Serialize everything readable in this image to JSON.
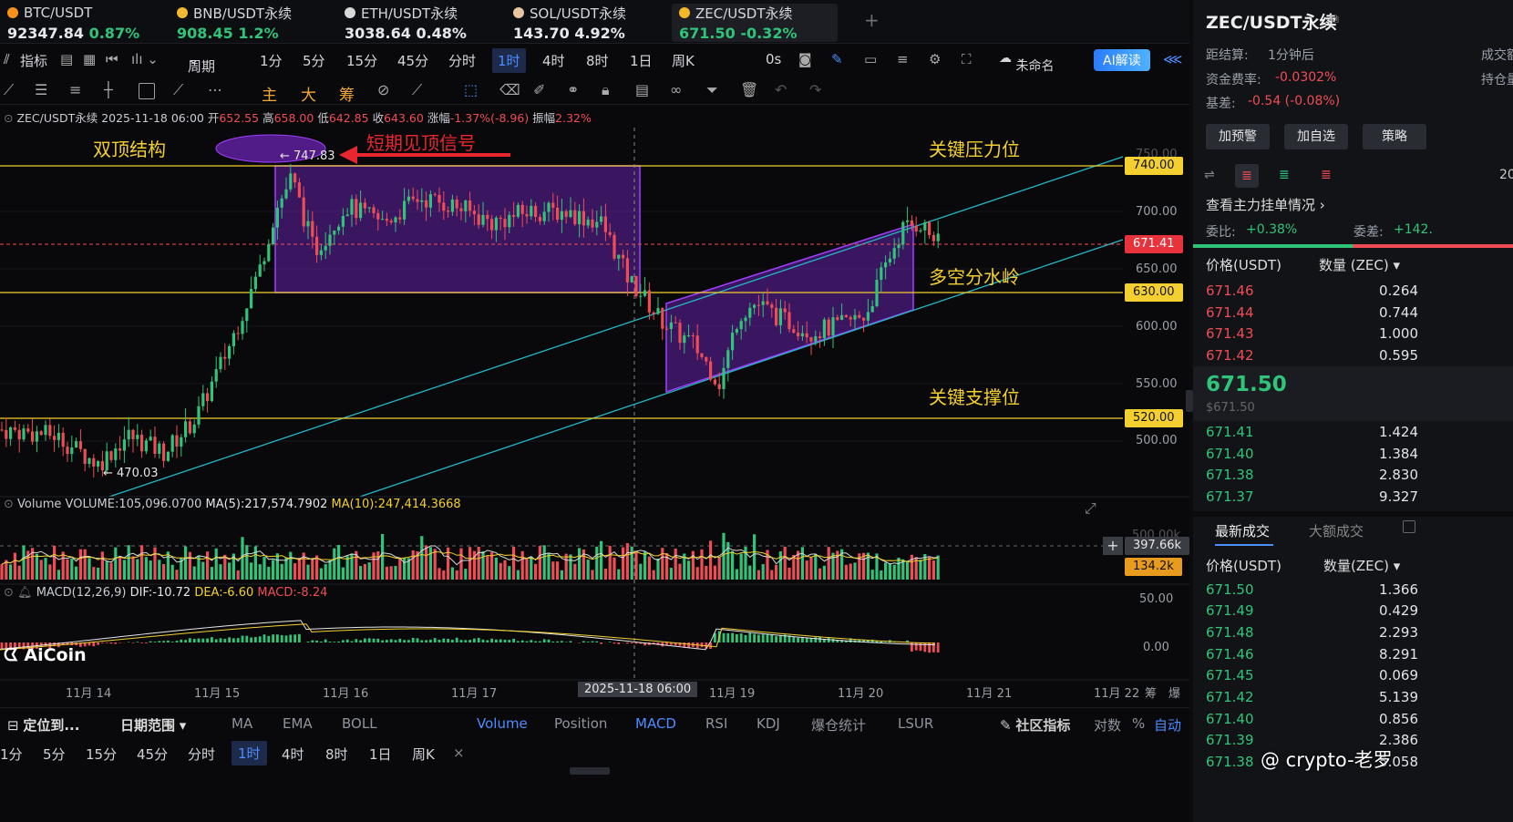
{
  "tickers": [
    {
      "name": "BTC/USDT",
      "price": "92347.84",
      "change": "0.87%",
      "dir": "up",
      "coin": "#f7931a"
    },
    {
      "name": "BNB/USDT永续",
      "price": "908.45",
      "change": "1.2%",
      "dir": "up",
      "coin": "#f3ba2f"
    },
    {
      "name": "ETH/USDT永续",
      "price": "3038.64",
      "change": "0.48%",
      "dir": "up",
      "coin": "#d8d8d8"
    },
    {
      "name": "SOL/USDT永续",
      "price": "143.70",
      "change": "4.92%",
      "dir": "up",
      "coin": "#e8c5a0"
    },
    {
      "name": "ZEC/USDT永续",
      "price": "671.50",
      "change": "-0.32%",
      "dir": "dn",
      "coin": "#f4b728"
    }
  ],
  "add_tab": "+",
  "toolbar": {
    "indicators": "指标",
    "period": "周期",
    "intervals": [
      "1分",
      "5分",
      "15分",
      "45分",
      "分时",
      "1时",
      "4时",
      "8时",
      "1日",
      "周K"
    ],
    "active_interval": "1时",
    "countdown": "0s",
    "layout_name": "未命名",
    "ai_button": "AI解读"
  },
  "drawbar": {
    "labels": [
      "主",
      "大",
      "筹"
    ]
  },
  "info": {
    "symbol": "ZEC/USDT永续",
    "datetime": "2025-11-18 06:00",
    "open_lbl": "开",
    "open": "652.55",
    "high_lbl": "高",
    "high": "658.00",
    "low_lbl": "低",
    "low": "642.85",
    "close_lbl": "收",
    "close": "643.60",
    "chg_lbl": "涨幅",
    "chg": "-1.37%(-8.96)",
    "amp_lbl": "振幅",
    "amp": "2.32%"
  },
  "annotations": {
    "double_top": "双顶结构",
    "short_top_signal": "短期见顶信号",
    "resistance": "关键压力位",
    "watershed": "多空分水岭",
    "support": "关键支撑位",
    "high_mark": "← 747.83",
    "low_mark": "← 470.03"
  },
  "price_axis": [
    "750.00",
    "700.00",
    "650.00",
    "600.00",
    "550.00",
    "500.00"
  ],
  "price_tags": {
    "r740": "740.00",
    "cur": "671.41",
    "r630": "630.00",
    "r520": "520.00"
  },
  "volume": {
    "label": "Volume",
    "vol": "VOLUME:105,096.0700",
    "ma5": "MA(5):217,574.7902",
    "ma10": "MA(10):247,414.3668",
    "axis_top": "500.00k",
    "tag1": "397.66k",
    "tag2": "134.2k"
  },
  "macd": {
    "label": "MACD(12,26,9)",
    "dif": "DIF:-10.72",
    "dea": "DEA:-6.60",
    "macd": "MACD:-8.24",
    "axis1": "50.00",
    "axis2": "0.00"
  },
  "watermark": "AiCoin",
  "time_axis": [
    "11月 14",
    "11月 15",
    "11月 16",
    "11月 17",
    "11月 19",
    "11月 20",
    "11月 21",
    "11月 22"
  ],
  "crosshair_time": "2025-11-18 06:00",
  "time_axis_right": [
    "筹",
    "爆"
  ],
  "bottom1": {
    "locate": "定位到...",
    "range": "日期范围",
    "items": [
      "MA",
      "EMA",
      "BOLL",
      "Volume",
      "Position",
      "MACD",
      "RSI",
      "KDJ",
      "爆仓统计",
      "LSUR"
    ],
    "community": "社区指标",
    "log": "对数",
    "pct": "%",
    "auto": "自动"
  },
  "bottom2": {
    "items": [
      "1分",
      "5分",
      "15分",
      "45分",
      "分时",
      "1时",
      "4时",
      "8时",
      "1日",
      "周K"
    ],
    "active": "1时",
    "close": "×"
  },
  "sidebar": {
    "title": "ZEC/USDT永续",
    "settle_lbl": "距结算:",
    "settle_val": "1分钟后",
    "vol_lbl": "成交额",
    "funding_lbl": "资金费率:",
    "funding_val": "-0.0302%",
    "oi_lbl": "持仓量",
    "basis_lbl": "基差:",
    "basis_val": "-0.54 (-0.08%)",
    "btn_alert": "加预警",
    "btn_fav": "加自选",
    "btn_strategy": "策略",
    "depth_num": "20",
    "mainforce": "查看主力挂单情况 ›",
    "ratio_lbl": "委比:",
    "ratio_val": "+0.38%",
    "diff_lbl": "委差:",
    "diff_val": "+142.",
    "col_price": "价格(USDT)",
    "col_qty": "数量 (ZEC) ▾",
    "asks": [
      {
        "p": "671.46",
        "q": "0.264"
      },
      {
        "p": "671.44",
        "q": "0.744"
      },
      {
        "p": "671.43",
        "q": "1.000"
      },
      {
        "p": "671.42",
        "q": "0.595"
      }
    ],
    "last": "671.50",
    "last_usd": "$671.50",
    "bids": [
      {
        "p": "671.41",
        "q": "1.424"
      },
      {
        "p": "671.40",
        "q": "1.384"
      },
      {
        "p": "671.38",
        "q": "2.830"
      },
      {
        "p": "671.37",
        "q": "9.327"
      }
    ],
    "tab_latest": "最新成交",
    "tab_large": "大额成交",
    "col_price2": "价格(USDT)",
    "col_qty2": "数量(ZEC) ▾",
    "trades": [
      {
        "p": "671.50",
        "q": "1.366"
      },
      {
        "p": "671.49",
        "q": "0.429"
      },
      {
        "p": "671.48",
        "q": "2.293"
      },
      {
        "p": "671.46",
        "q": "8.291"
      },
      {
        "p": "671.45",
        "q": "0.069"
      },
      {
        "p": "671.42",
        "q": "5.139"
      },
      {
        "p": "671.40",
        "q": "0.856"
      },
      {
        "p": "671.39",
        "q": "2.386"
      },
      {
        "p": "671.38",
        "q": "5.058"
      }
    ],
    "author": "@ crypto-老罗"
  },
  "colors": {
    "up": "#2fc47a",
    "down": "#ef4d56",
    "yellow": "#f3d02f",
    "purple": "#8a2be2",
    "cyan": "#22b8c6"
  }
}
